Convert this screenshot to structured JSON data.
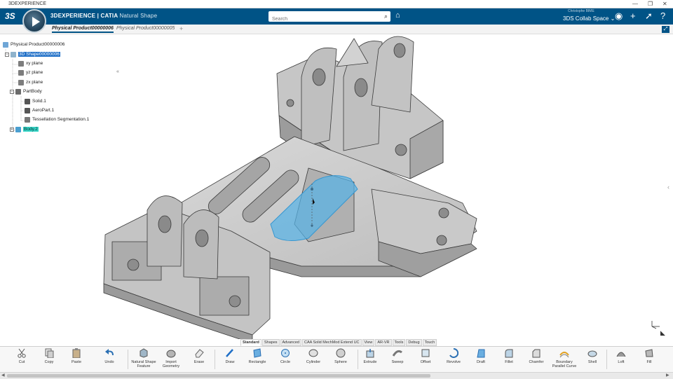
{
  "os_window": {
    "title": "3DEXPERIENCE",
    "controls": [
      "—",
      "❐",
      "✕"
    ]
  },
  "app": {
    "brand": "3DEXPERIENCE | CATIA",
    "app_name": "Natural Shape"
  },
  "search": {
    "placeholder": "Search"
  },
  "user": {
    "name": "Christophe BIME",
    "space": "3DS Collab Space ⌄"
  },
  "tabs": [
    {
      "label": "Physical Product00000006",
      "active": true
    },
    {
      "label": "Physical Product00000005",
      "active": false
    }
  ],
  "tree": [
    {
      "label": "Physical Product00000006"
    },
    {
      "label": "3D Shape00000006"
    },
    {
      "label": "xy plane"
    },
    {
      "label": "yz plane"
    },
    {
      "label": "zx plane"
    },
    {
      "label": "PartBody"
    },
    {
      "label": "Solid.1"
    },
    {
      "label": "AeroPart.1"
    },
    {
      "label": "Tessellation Segmentation.1"
    },
    {
      "label": "Body.2"
    }
  ],
  "ribbon_tabs": [
    "Standard",
    "Shapes",
    "Advanced",
    "CAA Solid MechMod Extend UC",
    "View",
    "AR-VR",
    "Tools",
    "Debug",
    "Touch"
  ],
  "tools": [
    {
      "label": "Cut",
      "icon": "scissors-icon"
    },
    {
      "label": "Copy",
      "icon": "copy-icon"
    },
    {
      "label": "Paste",
      "icon": "paste-icon"
    },
    {
      "label": "Undo",
      "icon": "undo-icon"
    },
    {
      "label": "Natural Shape Feature",
      "icon": "natural-shape-feature-icon"
    },
    {
      "label": "Import Geometry",
      "icon": "import-geometry-icon"
    },
    {
      "label": "Erase",
      "icon": "eraser-icon"
    },
    {
      "label": "Draw",
      "icon": "pencil-icon"
    },
    {
      "label": "Rectangle",
      "icon": "rectangle-icon"
    },
    {
      "label": "Circle",
      "icon": "circle-icon"
    },
    {
      "label": "Cylinder",
      "icon": "cylinder-icon"
    },
    {
      "label": "Sphere",
      "icon": "sphere-icon"
    },
    {
      "label": "Extrude",
      "icon": "extrude-icon"
    },
    {
      "label": "Sweep",
      "icon": "sweep-icon"
    },
    {
      "label": "Offset",
      "icon": "offset-icon"
    },
    {
      "label": "Revolve",
      "icon": "revolve-icon"
    },
    {
      "label": "Draft",
      "icon": "draft-icon"
    },
    {
      "label": "Fillet",
      "icon": "fillet-icon"
    },
    {
      "label": "Chamfer",
      "icon": "chamfer-icon"
    },
    {
      "label": "Boundary Parallel Curve",
      "icon": "boundary-parallel-curve-icon"
    },
    {
      "label": "Shell",
      "icon": "shell-icon"
    },
    {
      "label": "Loft",
      "icon": "loft-icon"
    },
    {
      "label": "Fill",
      "icon": "fill-icon"
    }
  ],
  "colors": {
    "header": "#005386",
    "selection": "#1f6fc7",
    "highlight": "#39d6c8",
    "part_face": "#c9c9c9",
    "selected_face": "#58b3e6"
  }
}
